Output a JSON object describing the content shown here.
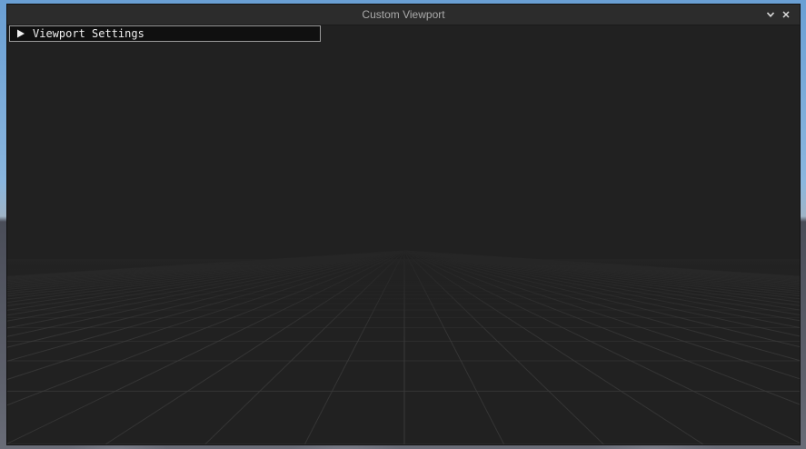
{
  "window": {
    "title": "Custom Viewport"
  },
  "icons": {
    "collapse": "chevron-down-icon",
    "close": "close-icon",
    "expand": "triangle-right-icon"
  },
  "settings_panel": {
    "label": "Viewport Settings",
    "expanded": false
  },
  "colors": {
    "window_bg": "#212121",
    "titlebar_bg": "#2c2c2c",
    "title_text": "#aaaaaa",
    "header_bg": "#101010",
    "header_border": "#9a9a9a",
    "grid_line": "#3c3c3c",
    "sky": "#7fb0dd",
    "terrain": "#585b66"
  }
}
